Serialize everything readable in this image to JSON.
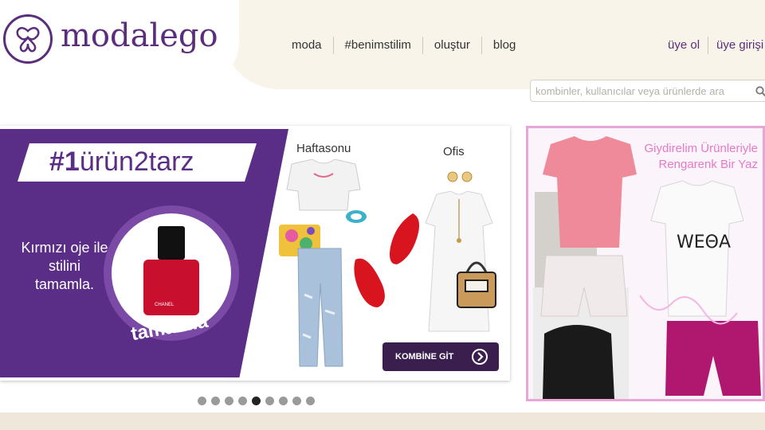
{
  "brand": {
    "logo_text": "modalego"
  },
  "nav": {
    "items": [
      "moda",
      "#benimstilim",
      "oluştur",
      "blog"
    ]
  },
  "user_nav": {
    "signup": "üye ol",
    "login": "üye girişi"
  },
  "search": {
    "placeholder": "kombinler, kullanıcılar veya ürünlerde ara"
  },
  "slide_main": {
    "tag_bold": "#1",
    "tag_rest": "ürün2tarz",
    "tip": "Kırmızı oje ile stilini tamamla.",
    "product_label": "CHANEL",
    "circle_caption": "tamamla",
    "col_weekend": "Haftasonu",
    "col_office": "Ofis",
    "button": "KOMBİNE GİT"
  },
  "slide_side": {
    "title_line1": "Giydirelim Ürünleriyle",
    "title_line2": "Rengarenk Bir Yaz"
  },
  "pagination": {
    "count": 9,
    "active_index": 4
  },
  "colors": {
    "brand_purple": "#5b2e7c",
    "header_cream": "#f8f4ea",
    "nail_red": "#c8102e",
    "side_pink": "#e779c9"
  }
}
